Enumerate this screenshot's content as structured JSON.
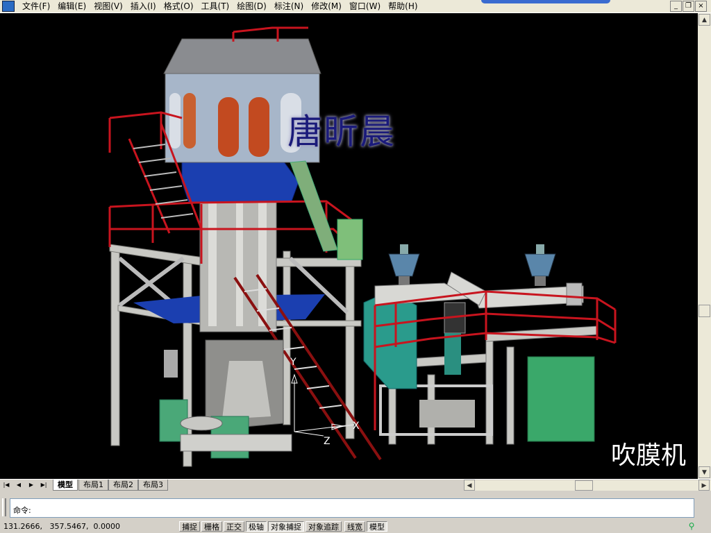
{
  "menu": [
    {
      "label": "文件(F)"
    },
    {
      "label": "编辑(E)"
    },
    {
      "label": "视图(V)"
    },
    {
      "label": "插入(I)"
    },
    {
      "label": "格式(O)"
    },
    {
      "label": "工具(T)"
    },
    {
      "label": "绘图(D)"
    },
    {
      "label": "标注(N)"
    },
    {
      "label": "修改(M)"
    },
    {
      "label": "窗口(W)"
    },
    {
      "label": "帮助(H)"
    }
  ],
  "window_buttons": {
    "minimize": "_",
    "restore": "❐",
    "close": "×"
  },
  "drawing": {
    "author_text": "唐昕晨",
    "machine_label": "吹膜机",
    "ucs": {
      "y": "Y",
      "x": "X",
      "z": "Z"
    }
  },
  "tabs": [
    {
      "label": "模型",
      "active": true
    },
    {
      "label": "布局1",
      "active": false
    },
    {
      "label": "布局2",
      "active": false
    },
    {
      "label": "布局3",
      "active": false
    }
  ],
  "command": {
    "prompt": "命令:"
  },
  "status": {
    "coordinates": "131.2666,   357.5467,  0.0000",
    "buttons": [
      {
        "label": "捕捉",
        "pressed": false
      },
      {
        "label": "栅格",
        "pressed": false
      },
      {
        "label": "正交",
        "pressed": false
      },
      {
        "label": "极轴",
        "pressed": true
      },
      {
        "label": "对象捕捉",
        "pressed": true
      },
      {
        "label": "对象追踪",
        "pressed": false
      },
      {
        "label": "线宽",
        "pressed": false
      },
      {
        "label": "模型",
        "pressed": true
      }
    ]
  },
  "colors": {
    "canvas": "#000000",
    "steel": "#c9c9c4",
    "rail": "#c8141e",
    "blue": "#1b3fb0",
    "teal": "#2a9b8c",
    "green": "#3aa86a"
  }
}
